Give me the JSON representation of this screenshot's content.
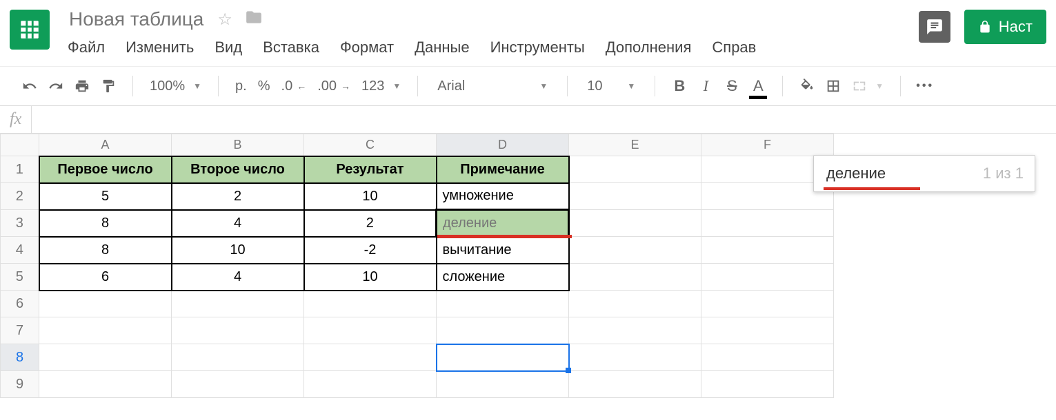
{
  "header": {
    "title": "Новая таблица",
    "menu": [
      "Файл",
      "Изменить",
      "Вид",
      "Вставка",
      "Формат",
      "Данные",
      "Инструменты",
      "Дополнения",
      "Справ"
    ],
    "share_label": "Наст"
  },
  "toolbar": {
    "zoom": "100%",
    "currency": "р.",
    "percent": "%",
    "dec_less": ".0",
    "dec_more": ".00",
    "numfmt": "123",
    "font": "Arial",
    "size": "10"
  },
  "formula": "",
  "columns": [
    "A",
    "B",
    "C",
    "D",
    "E",
    "F"
  ],
  "rows": [
    "1",
    "2",
    "3",
    "4",
    "5",
    "6",
    "7",
    "8",
    "9"
  ],
  "table": {
    "headers": [
      "Первое число",
      "Второе число",
      "Результат",
      "Примечание"
    ],
    "data": [
      [
        "5",
        "2",
        "10",
        "умножение"
      ],
      [
        "8",
        "4",
        "2",
        "деление"
      ],
      [
        "8",
        "10",
        "-2",
        "вычитание"
      ],
      [
        "6",
        "4",
        "10",
        "сложение"
      ]
    ]
  },
  "find": {
    "query": "деление",
    "count": "1 из 1"
  },
  "selection": {
    "row": 8,
    "col": "D"
  }
}
